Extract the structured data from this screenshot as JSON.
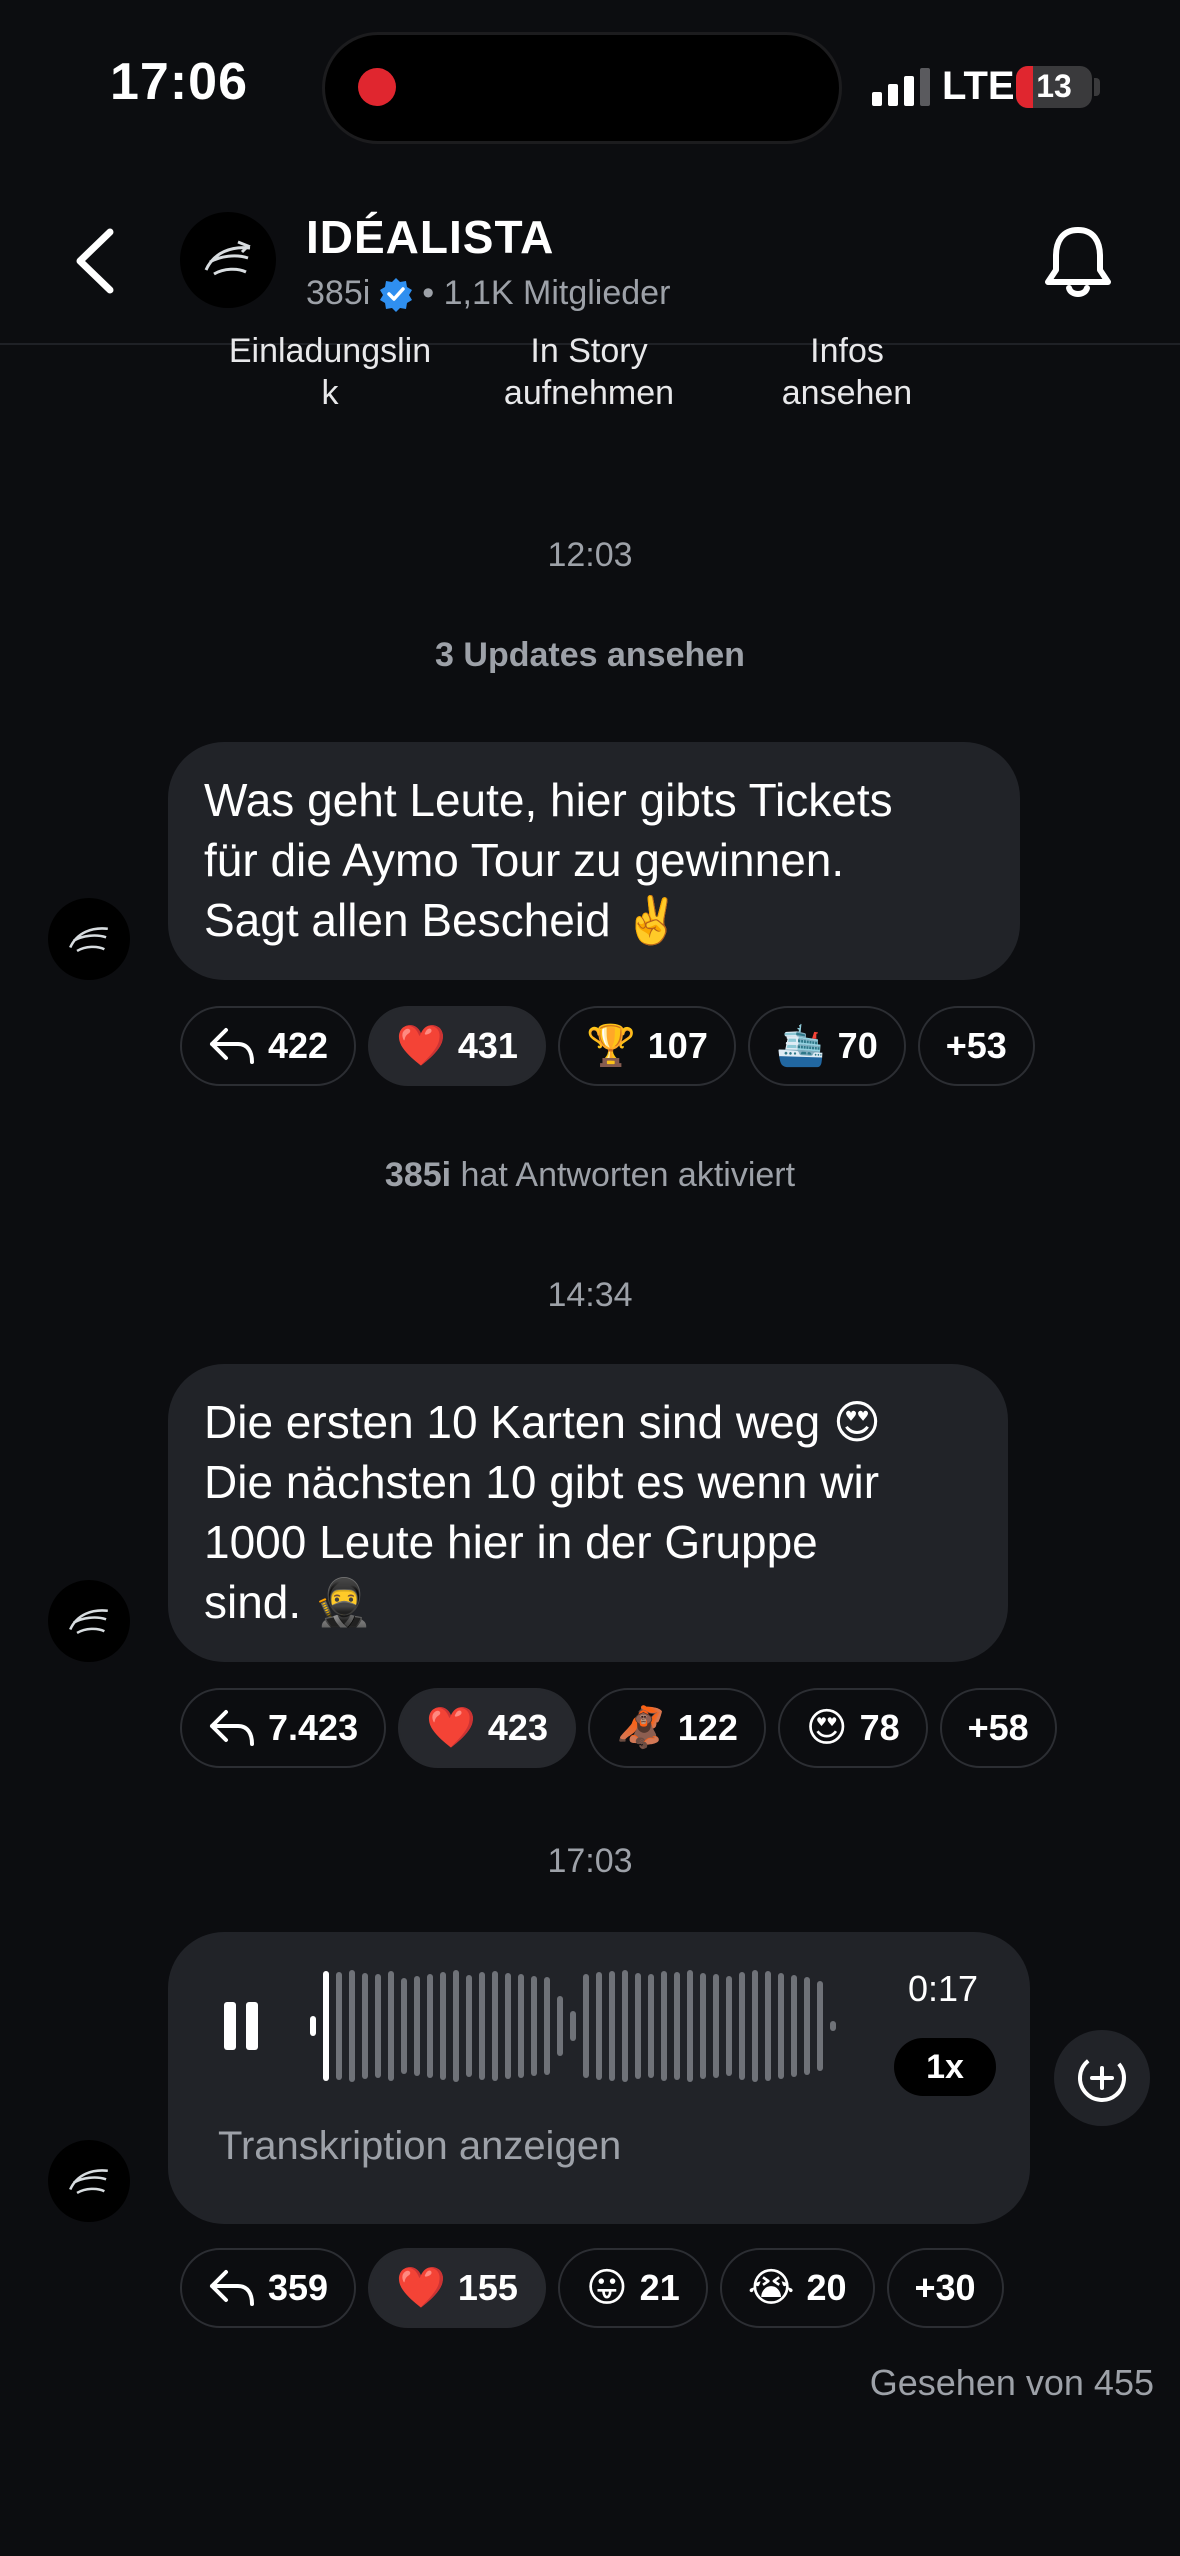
{
  "status_bar": {
    "time": "17:06",
    "network": "LTE",
    "battery": "13"
  },
  "header": {
    "title": "IDÉALISTA",
    "owner": "385i",
    "members": "• 1,1K Mitglieder"
  },
  "actions": [
    {
      "line1": "Einladungslin",
      "line2": "k"
    },
    {
      "line1": "In Story",
      "line2": "aufnehmen"
    },
    {
      "line1": "Infos",
      "line2": "ansehen"
    }
  ],
  "chat": {
    "date1": "12:03",
    "updates_link": "3 Updates ansehen",
    "msg1": {
      "lines": [
        "Was geht Leute, hier gibts Tickets",
        "für die Aymo Tour zu gewinnen.",
        "Sagt allen Bescheid ✌️"
      ],
      "replies": "422",
      "reactions": [
        {
          "emoji": "❤️",
          "count": "431"
        },
        {
          "emoji": "🏆",
          "count": "107"
        },
        {
          "emoji": "🛳️",
          "count": "70"
        }
      ],
      "more": "+53"
    },
    "service": {
      "name": "385i",
      "text": " hat Antworten aktiviert"
    },
    "date2": "14:34",
    "msg2": {
      "lines": [
        "Die ersten 10 Karten sind weg 😍",
        "Die nächsten 10 gibt es wenn wir",
        "1000 Leute hier in der Gruppe",
        "sind. 🥷"
      ],
      "replies": "7.423",
      "reactions": [
        {
          "emoji": "❤️",
          "count": "423"
        },
        {
          "emoji": "🦧",
          "count": "122"
        },
        {
          "emoji": "😍",
          "count": "78"
        }
      ],
      "more": "+58"
    },
    "date3": "17:03",
    "voice": {
      "duration": "0:17",
      "speed": "1x",
      "transcript": "Transkription anzeigen",
      "progress": 0.05
    },
    "msg3": {
      "replies": "359",
      "reactions": [
        {
          "emoji": "❤️",
          "count": "155"
        },
        {
          "emoji": "😛",
          "count": "21"
        },
        {
          "emoji": "😭",
          "count": "20"
        }
      ],
      "more": "+30"
    },
    "seen": "Gesehen von 455"
  }
}
